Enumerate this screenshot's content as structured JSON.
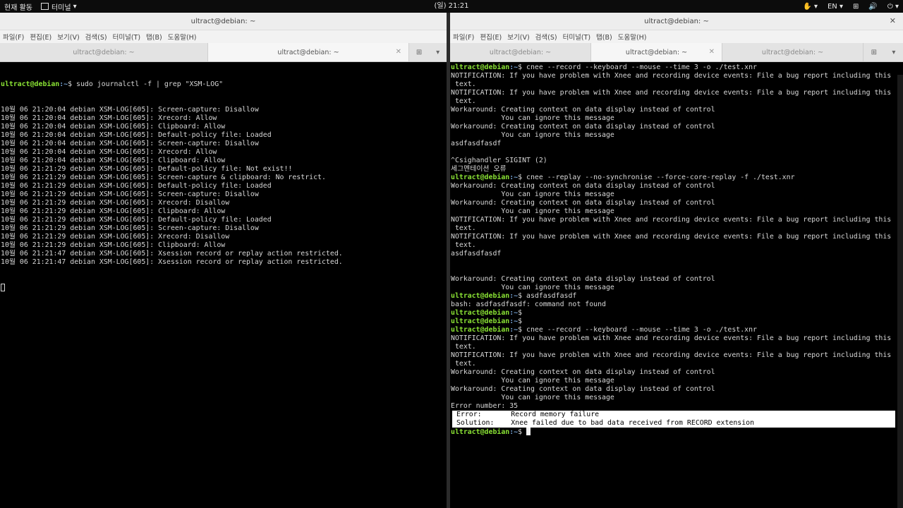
{
  "topbar": {
    "activities": "현재 활동",
    "app_menu": "터미널",
    "clock": "(일) 21:21",
    "input_method_glyph": "✋",
    "lang": "EN",
    "network_glyph": "⊞",
    "sound_glyph": "🔊",
    "power_glyph": "⏻"
  },
  "left": {
    "title": "ultract@debian: ~",
    "menu": [
      "파일(F)",
      "편집(E)",
      "보기(V)",
      "검색(S)",
      "터미널(T)",
      "탭(B)",
      "도움말(H)"
    ],
    "tabs": [
      "ultract@debian: ~",
      "ultract@debian: ~"
    ],
    "active_tab": 1,
    "command": "sudo journalctl -f | grep \"XSM-LOG\"",
    "log": [
      "10월 06 21:20:04 debian XSM-LOG[605]: Screen-capture: Disallow",
      "10월 06 21:20:04 debian XSM-LOG[605]: Xrecord: Allow",
      "10월 06 21:20:04 debian XSM-LOG[605]: Clipboard: Allow",
      "10월 06 21:20:04 debian XSM-LOG[605]: Default-policy file: Loaded",
      "10월 06 21:20:04 debian XSM-LOG[605]: Screen-capture: Disallow",
      "10월 06 21:20:04 debian XSM-LOG[605]: Xrecord: Allow",
      "10월 06 21:20:04 debian XSM-LOG[605]: Clipboard: Allow",
      "10월 06 21:21:29 debian XSM-LOG[605]: Default-policy file: Not exist!!",
      "10월 06 21:21:29 debian XSM-LOG[605]: Screen-capture & clipboard: No restrict.",
      "10월 06 21:21:29 debian XSM-LOG[605]: Default-policy file: Loaded",
      "10월 06 21:21:29 debian XSM-LOG[605]: Screen-capture: Disallow",
      "10월 06 21:21:29 debian XSM-LOG[605]: Xrecord: Disallow",
      "10월 06 21:21:29 debian XSM-LOG[605]: Clipboard: Allow",
      "10월 06 21:21:29 debian XSM-LOG[605]: Default-policy file: Loaded",
      "10월 06 21:21:29 debian XSM-LOG[605]: Screen-capture: Disallow",
      "10월 06 21:21:29 debian XSM-LOG[605]: Xrecord: Disallow",
      "10월 06 21:21:29 debian XSM-LOG[605]: Clipboard: Allow",
      "10월 06 21:21:47 debian XSM-LOG[605]: Xsession record or replay action restricted.",
      "10월 06 21:21:47 debian XSM-LOG[605]: Xsession record or replay action restricted."
    ]
  },
  "right": {
    "title": "ultract@debian: ~",
    "menu": [
      "파일(F)",
      "편집(E)",
      "보기(V)",
      "검색(S)",
      "터미널(T)",
      "탭(B)",
      "도움말(H)"
    ],
    "tabs": [
      "ultract@debian: ~",
      "ultract@debian: ~",
      "ultract@debian: ~"
    ],
    "active_tab": 1,
    "prompt_user": "ultract@debian",
    "prompt_path": ":~",
    "lines": [
      {
        "p": true,
        "t": "$ cnee --record --keyboard --mouse --time 3 -o ./test.xnr"
      },
      {
        "t": "NOTIFICATION: If you have problem with Xnee and recording device events: File a bug report including this"
      },
      {
        "t": " text."
      },
      {
        "t": "NOTIFICATION: If you have problem with Xnee and recording device events: File a bug report including this"
      },
      {
        "t": " text."
      },
      {
        "t": "Workaround: Creating context on data display instead of control"
      },
      {
        "t": "            You can ignore this message"
      },
      {
        "t": "Workaround: Creating context on data display instead of control"
      },
      {
        "t": "            You can ignore this message"
      },
      {
        "t": "asdfasdfasdf"
      },
      {
        "t": ""
      },
      {
        "t": "^Csighandler SIGINT (2)"
      },
      {
        "t": "세그멘테이션 오류"
      },
      {
        "p": true,
        "t": "$ cnee --replay --no-synchronise --force-core-replay -f ./test.xnr"
      },
      {
        "t": "Workaround: Creating context on data display instead of control"
      },
      {
        "t": "            You can ignore this message"
      },
      {
        "t": "Workaround: Creating context on data display instead of control"
      },
      {
        "t": "            You can ignore this message"
      },
      {
        "t": "NOTIFICATION: If you have problem with Xnee and recording device events: File a bug report including this"
      },
      {
        "t": " text."
      },
      {
        "t": "NOTIFICATION: If you have problem with Xnee and recording device events: File a bug report including this"
      },
      {
        "t": " text."
      },
      {
        "t": "asdfasdfasdf"
      },
      {
        "t": ""
      },
      {
        "t": ""
      },
      {
        "t": "Workaround: Creating context on data display instead of control"
      },
      {
        "t": "            You can ignore this message"
      },
      {
        "p": true,
        "t": "$ asdfasdfasdf"
      },
      {
        "t": "bash: asdfasdfasdf: command not found"
      },
      {
        "p": true,
        "t": "$"
      },
      {
        "p": true,
        "t": "$"
      },
      {
        "p": true,
        "t": "$ cnee --record --keyboard --mouse --time 3 -o ./test.xnr"
      },
      {
        "t": "NOTIFICATION: If you have problem with Xnee and recording device events: File a bug report including this"
      },
      {
        "t": " text."
      },
      {
        "t": "NOTIFICATION: If you have problem with Xnee and recording device events: File a bug report including this"
      },
      {
        "t": " text."
      },
      {
        "t": "Workaround: Creating context on data display instead of control"
      },
      {
        "t": "            You can ignore this message"
      },
      {
        "t": "Workaround: Creating context on data display instead of control"
      },
      {
        "t": "            You can ignore this message"
      },
      {
        "t": "Error number: 35"
      },
      {
        "err": true,
        "t": " Error:       Record memory failure"
      },
      {
        "err": true,
        "t": " Solution:    Xnee failed due to bad data received from RECORD extension"
      },
      {
        "p": true,
        "cursor": true,
        "t": "$ "
      }
    ]
  },
  "colors": {
    "prompt_user": "#8ae234",
    "prompt_path": "#729fcf",
    "terminal_bg": "#000000",
    "terminal_fg": "#d8d8d8"
  },
  "icons": {
    "dropdown": "▾",
    "close": "✕",
    "new_tab": "⊞",
    "tab_menu": "▾"
  }
}
